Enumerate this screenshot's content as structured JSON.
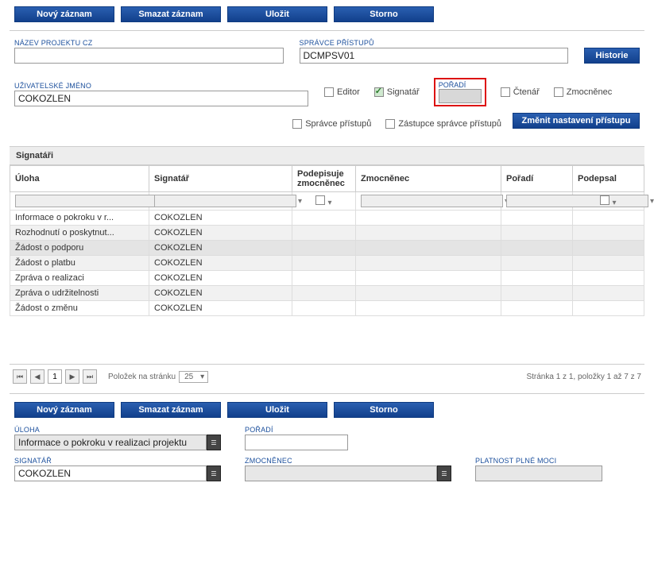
{
  "toolbar": {
    "novy": "Nový záznam",
    "smazat": "Smazat záznam",
    "ulozit": "Uložit",
    "storno": "Storno"
  },
  "topForm": {
    "nazev_label": "NÁZEV PROJEKTU CZ",
    "nazev_value": "",
    "spravce_label": "SPRÁVCE PŘÍSTUPŮ",
    "spravce_value": "DCMPSV01",
    "historie": "Historie",
    "uziv_label": "UŽIVATELSKÉ JMÉNO",
    "uziv_value": "COKOZLEN",
    "editor": "Editor",
    "signatar": "Signatář",
    "poradi_label": "POŘADÍ",
    "ctenar": "Čtenář",
    "zmocnenec": "Zmocněnec",
    "spravce_pristupu": "Správce přístupů",
    "zastupce": "Zástupce správce přístupů",
    "zmenit": "Změnit nastavení přístupu"
  },
  "gridTitle": "Signatáři",
  "cols": {
    "uloha": "Úloha",
    "signatar": "Signatář",
    "podepisuje": "Podepisuje zmocněnec",
    "zmocnenec": "Zmocněnec",
    "poradi": "Pořadí",
    "podepsal": "Podepsal"
  },
  "rows": [
    {
      "uloha": "Informace o pokroku v r...",
      "sig": "COKOZLEN",
      "sel": true
    },
    {
      "uloha": "Rozhodnutí o poskytnut...",
      "sig": "COKOZLEN"
    },
    {
      "uloha": "Žádost o podporu",
      "sig": "COKOZLEN",
      "hi": true
    },
    {
      "uloha": "Žádost o platbu",
      "sig": "COKOZLEN"
    },
    {
      "uloha": "Zpráva o realizaci",
      "sig": "COKOZLEN"
    },
    {
      "uloha": "Zpráva o udržitelnosti",
      "sig": "COKOZLEN"
    },
    {
      "uloha": "Žádost o změnu",
      "sig": "COKOZLEN"
    }
  ],
  "pager": {
    "items_label": "Položek na stránku",
    "perPage": "25",
    "page": "1",
    "summary": "Stránka 1 z 1, položky 1 až 7 z 7"
  },
  "lower": {
    "uloha_label": "ÚLOHA",
    "uloha_value": "Informace o pokroku v realizaci projektu",
    "poradi_label": "POŘADÍ",
    "poradi_value": "",
    "signatar_label": "SIGNATÁŘ",
    "signatar_value": "COKOZLEN",
    "zmocnenec_label": "ZMOCNĚNEC",
    "zmocnenec_value": "",
    "platnost_label": "PLATNOST PLNÉ MOCI",
    "platnost_value": ""
  }
}
